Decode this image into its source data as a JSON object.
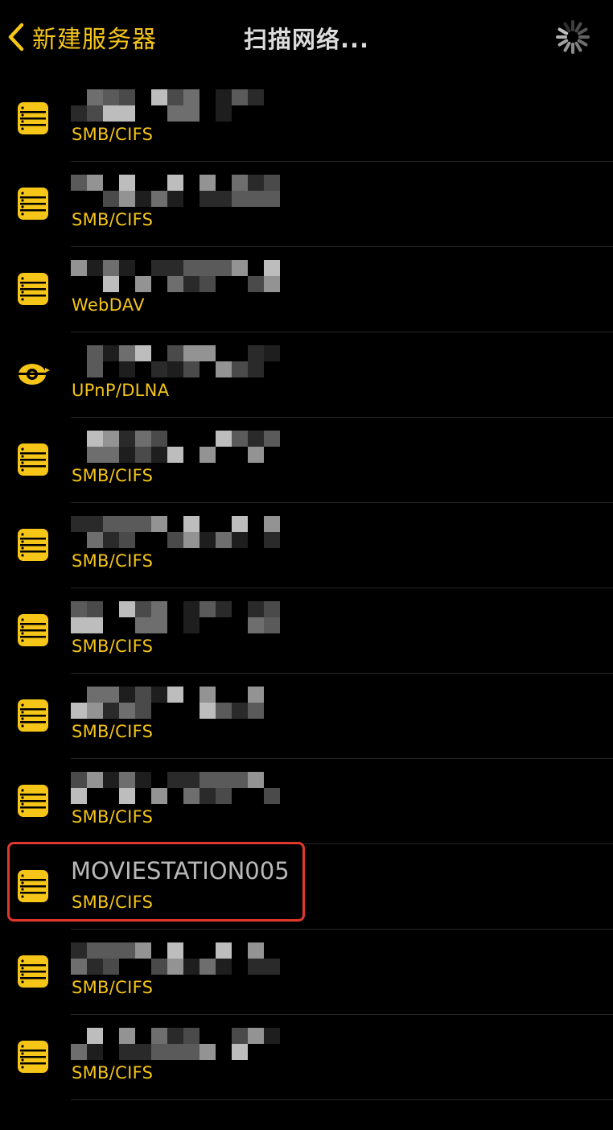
{
  "nav": {
    "back_label": "新建服务器",
    "title": "扫描网络..."
  },
  "icons": {
    "back": "chevron-left-icon",
    "spinner": "loading-spinner-icon",
    "server": "server-stack-icon",
    "upnp": "network-node-icon"
  },
  "colors": {
    "accent": "#f5c518",
    "background": "#000000",
    "highlight_border": "#e0392b",
    "separator": "#262626",
    "name_text": "#b9b9b9"
  },
  "servers": [
    {
      "name": "",
      "protocol": "SMB/CIFS",
      "icon": "server",
      "redacted": true
    },
    {
      "name": "",
      "protocol": "SMB/CIFS",
      "icon": "server",
      "redacted": true
    },
    {
      "name": "",
      "protocol": "WebDAV",
      "icon": "server",
      "redacted": true
    },
    {
      "name": "",
      "protocol": "UPnP/DLNA",
      "icon": "upnp",
      "redacted": true
    },
    {
      "name": "",
      "protocol": "SMB/CIFS",
      "icon": "server",
      "redacted": true
    },
    {
      "name": "",
      "protocol": "SMB/CIFS",
      "icon": "server",
      "redacted": true
    },
    {
      "name": "",
      "protocol": "SMB/CIFS",
      "icon": "server",
      "redacted": true
    },
    {
      "name": "",
      "protocol": "SMB/CIFS",
      "icon": "server",
      "redacted": true
    },
    {
      "name": "",
      "protocol": "SMB/CIFS",
      "icon": "server",
      "redacted": true
    },
    {
      "name": "MOVIESTATION005",
      "protocol": "SMB/CIFS",
      "icon": "server",
      "redacted": false,
      "highlighted": true
    },
    {
      "name": "",
      "protocol": "SMB/CIFS",
      "icon": "server",
      "redacted": true
    },
    {
      "name": "",
      "protocol": "SMB/CIFS",
      "icon": "server",
      "redacted": true
    }
  ]
}
